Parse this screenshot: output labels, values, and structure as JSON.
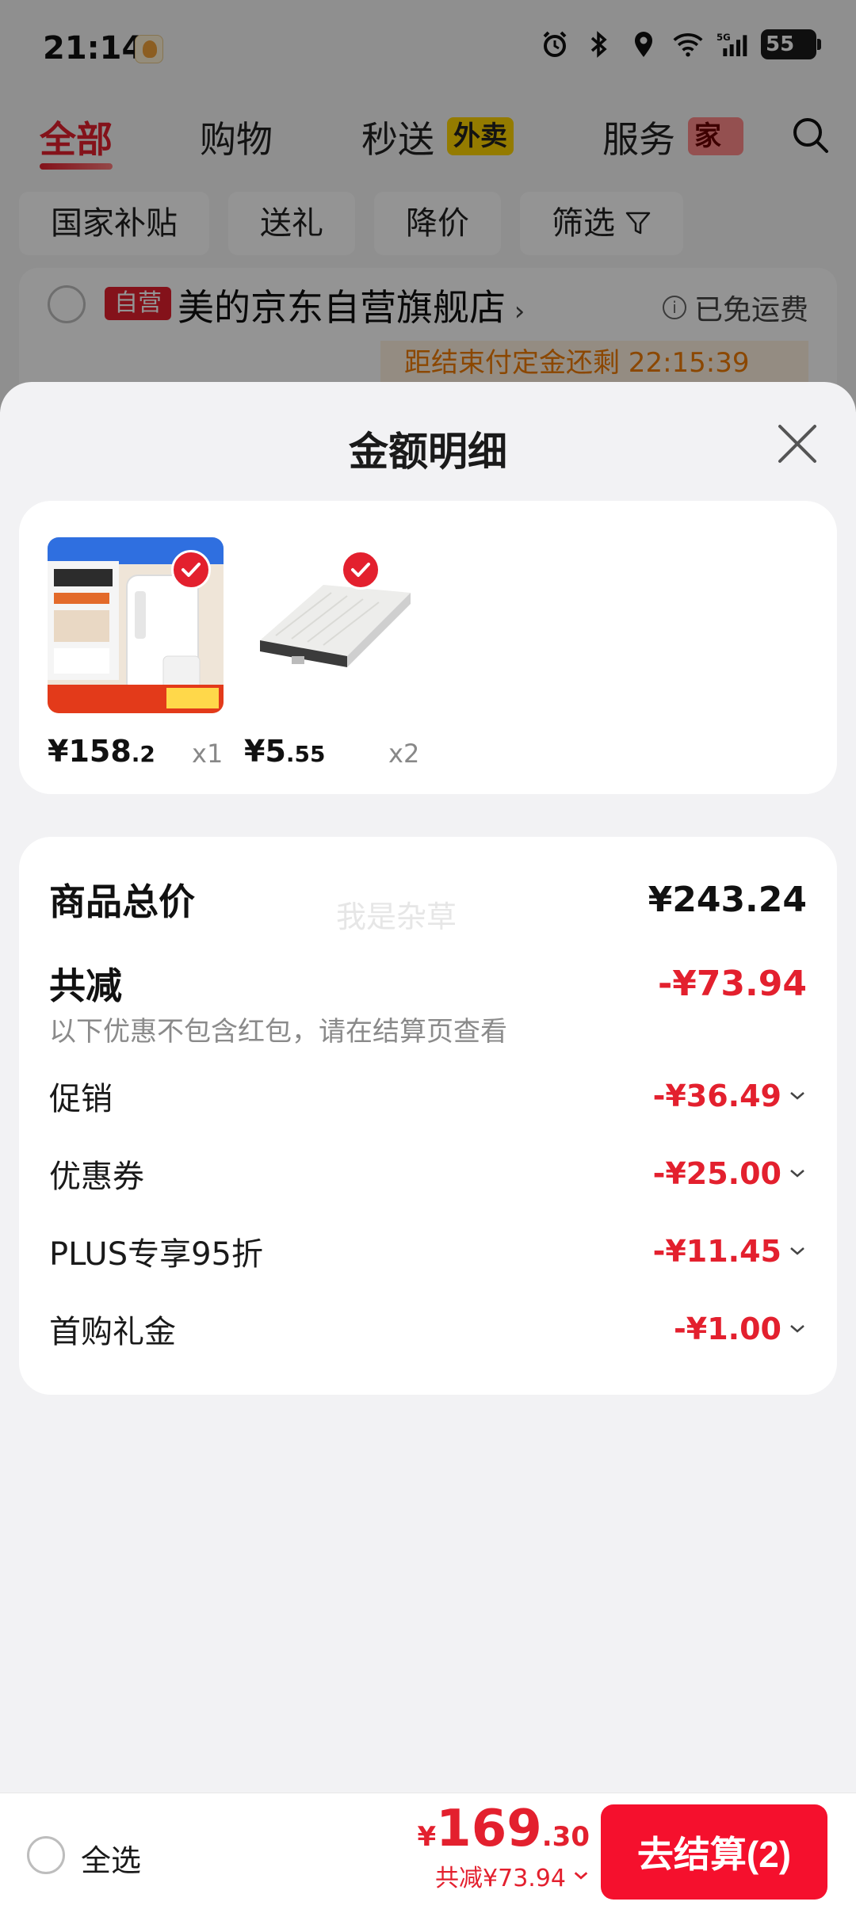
{
  "status_bar": {
    "time": "21:14",
    "network": "5G",
    "battery": "55"
  },
  "top_tabs": [
    {
      "label": "全部",
      "active": true
    },
    {
      "label": "购物",
      "active": false
    },
    {
      "label": "秒送",
      "tag": "外卖",
      "active": false
    },
    {
      "label": "服务",
      "tag": "家政",
      "active": false
    }
  ],
  "filters": [
    "国家补贴",
    "送礼",
    "降价",
    "筛选"
  ],
  "store": {
    "badge": "自营",
    "name": "美的京东自营旗舰店",
    "shipping": "已免运费",
    "deposit_notice": "距结束付定金还剩 22:15:39"
  },
  "sheet": {
    "title": "金额明细",
    "products": [
      {
        "price_symbol": "¥",
        "price_int": "158",
        "price_dec": ".2",
        "qty": "x1",
        "icon": "water-dispenser-image",
        "checked": true
      },
      {
        "price_symbol": "¥",
        "price_int": "5",
        "price_dec": ".55",
        "qty": "x2",
        "icon": "filter-cartridge-image",
        "checked": true
      }
    ],
    "summary": {
      "total_label": "商品总价",
      "total_value": "¥243.24",
      "watermark": "我是杂草",
      "discount_label": "共减",
      "discount_value": "-¥73.94",
      "discount_note": "以下优惠不包含红包，请在结算页查看",
      "items": [
        {
          "label": "促销",
          "value": "-¥36.49"
        },
        {
          "label": "优惠券",
          "value": "-¥25.00"
        },
        {
          "label": "PLUS专享95折",
          "value": "-¥11.45"
        },
        {
          "label": "首购礼金",
          "value": "-¥1.00"
        }
      ]
    }
  },
  "bottom_bar": {
    "select_all": "全选",
    "total_symbol": "¥",
    "total_int": "169",
    "total_dec": ".30",
    "saved": "共减¥73.94",
    "checkout": "去结算(2)"
  },
  "colors": {
    "accent": "#e3202e",
    "button": "#f5102d",
    "deposit": "#f07a00"
  }
}
